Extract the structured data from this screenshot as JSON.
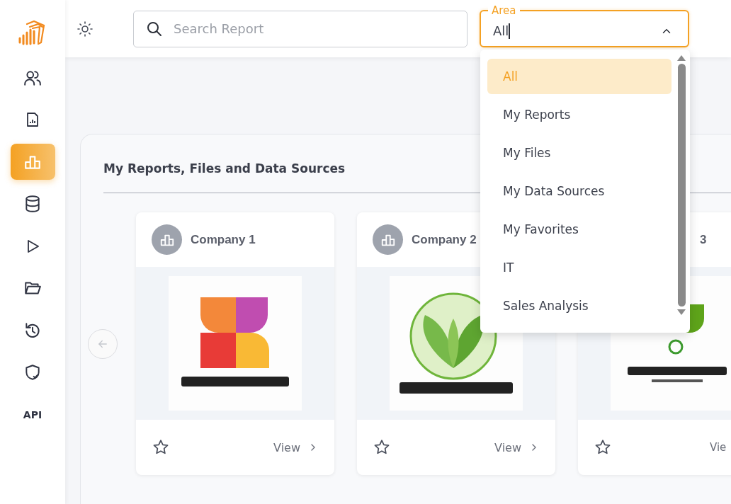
{
  "sidebar": {
    "items": [
      {
        "selected": false
      },
      {
        "selected": false
      },
      {
        "selected": true
      },
      {
        "selected": false
      },
      {
        "selected": false
      },
      {
        "selected": false
      },
      {
        "selected": false
      },
      {
        "selected": false
      },
      {
        "label": "API",
        "selected": false
      }
    ]
  },
  "search": {
    "placeholder": "Search Report"
  },
  "area": {
    "label": "Area",
    "value": "All",
    "expanded": true,
    "options": [
      {
        "label": "All",
        "selected": true
      },
      {
        "label": "My Reports",
        "selected": false
      },
      {
        "label": "My Files",
        "selected": false
      },
      {
        "label": "My Data Sources",
        "selected": false
      },
      {
        "label": "My Favorites",
        "selected": false
      },
      {
        "label": "IT",
        "selected": false
      },
      {
        "label": "Sales Analysis",
        "selected": false
      }
    ]
  },
  "panel": {
    "title": "My Reports, Files and Data Sources",
    "cards": [
      {
        "title": "Company 1",
        "covered": false,
        "view": "View"
      },
      {
        "title": "Company 2",
        "covered": false,
        "view": "View"
      },
      {
        "title": "3",
        "covered": true,
        "view": "Vie"
      }
    ]
  }
}
